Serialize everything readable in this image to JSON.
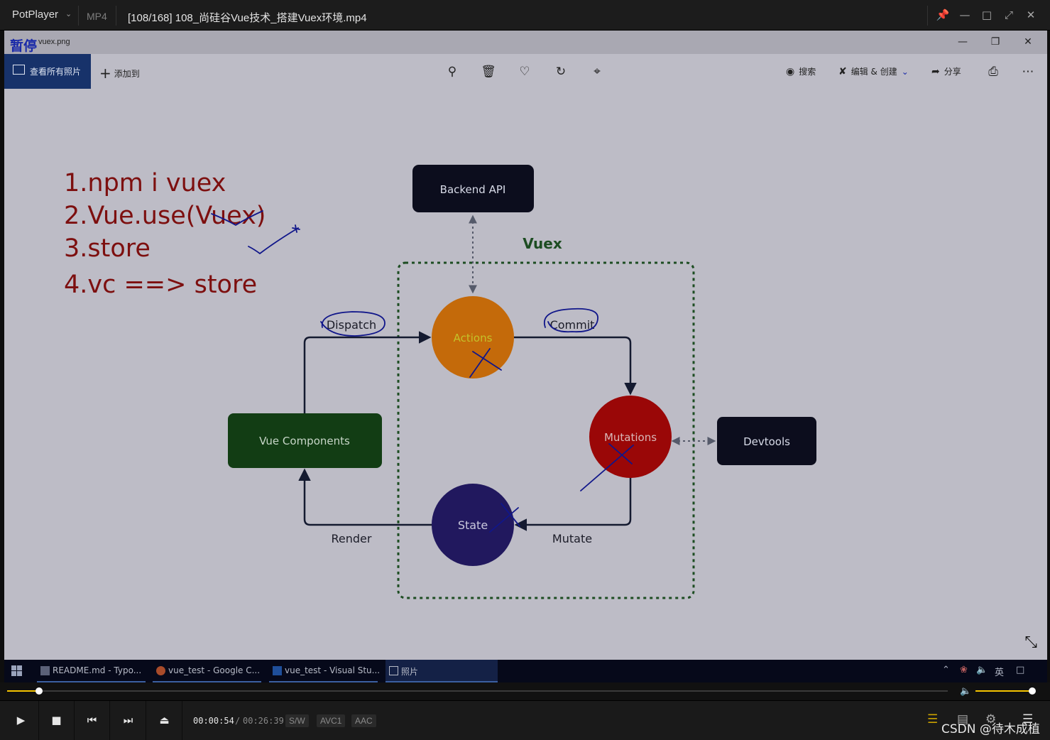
{
  "player": {
    "brand": "PotPlayer",
    "format": "MP4",
    "file_title": "[108/168] 108_尚硅谷Vue技术_搭建Vuex环境.mp4"
  },
  "photos_app": {
    "paused_label": "暂停",
    "window_title": "vuex.png",
    "all_photos_label": "查看所有照片",
    "add_label": "添加到",
    "search_label": "搜索",
    "edit_create_label": "编辑 & 创建",
    "share_label": "分享"
  },
  "notes": {
    "lines": [
      "1.npm i vuex",
      "2.Vue.use(Vuex)",
      "3.store",
      "4.vc ==> store"
    ]
  },
  "diagram": {
    "backend_api": "Backend API",
    "vuex": "Vuex",
    "actions": "Actions",
    "mutations": "Mutations",
    "state": "State",
    "vue_components": "Vue Components",
    "devtools": "Devtools",
    "dispatch": "Dispatch",
    "commit": "Commit",
    "mutate": "Mutate",
    "render": "Render",
    "colors": {
      "actions": "#c46a0a",
      "mutations": "#9a0707",
      "state": "#21185e",
      "vue_components": "#123d14",
      "dark_box": "#0c0d1d",
      "vuex_border": "#1d4d22",
      "ink": "#10168a"
    }
  },
  "taskbar": {
    "items": [
      {
        "label": "README.md - Typo..."
      },
      {
        "label": "vue_test - Google C..."
      },
      {
        "label": "vue_test - Visual Stu..."
      },
      {
        "label": "照片"
      }
    ],
    "ime_label": "英"
  },
  "playback": {
    "current_time": "00:00:54",
    "separator": "/",
    "total_time": "00:26:39",
    "progress": 0.034,
    "volume": 1.0,
    "chips": [
      "S/W",
      "AVC1",
      "AAC"
    ]
  },
  "watermark": "CSDN @待木成植"
}
